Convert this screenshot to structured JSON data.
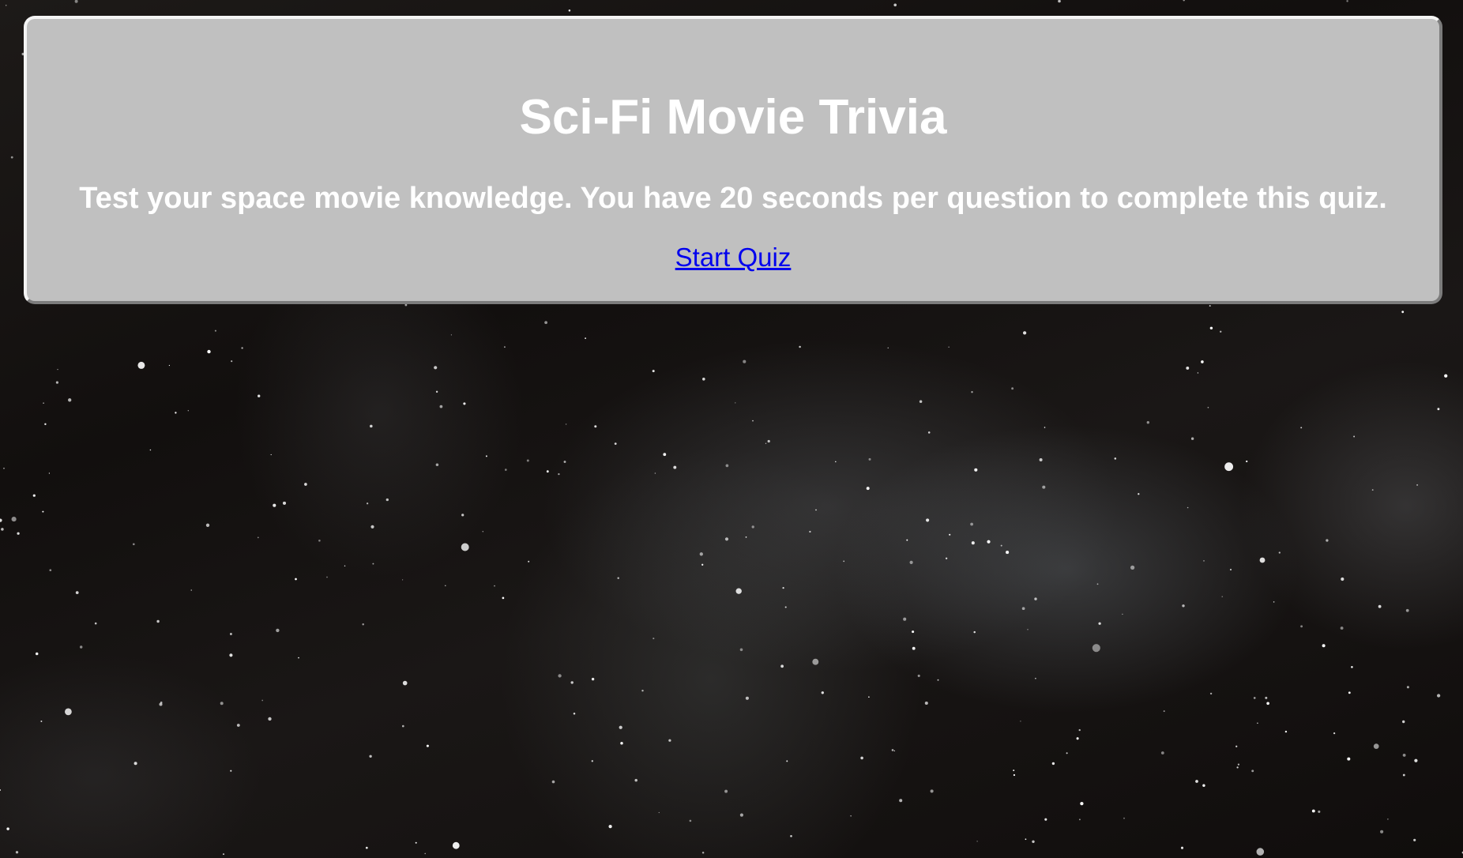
{
  "page": {
    "title": "Sci-Fi Movie Trivia",
    "description": "Test your space movie knowledge. You have 20 seconds per question to complete this quiz.",
    "start_link_label": "Start Quiz"
  },
  "colors": {
    "card_background": "#c0c0c0",
    "heading_text": "#ffffff",
    "link": "#0000ee",
    "background": "#141110"
  },
  "background_image": "starry-nebula-space-photo"
}
